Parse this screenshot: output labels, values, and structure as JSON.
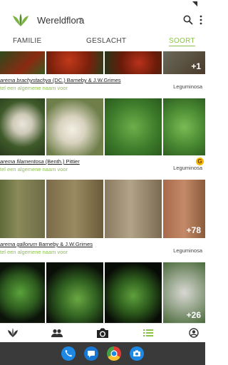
{
  "app": {
    "title": "Wereldflora"
  },
  "tabs": [
    {
      "label": "FAMILIE",
      "active": false
    },
    {
      "label": "GESLACHT",
      "active": false
    },
    {
      "label": "SOORT",
      "active": true
    }
  ],
  "species": [
    {
      "genus_part": "arema brachystachya",
      "author": " (DC.) Barneby & J.W.Grimes",
      "common": "tel een algemene naam voor",
      "family": "Leguminosa",
      "more": "+1"
    },
    {
      "genus_part": "arema filamentosa",
      "author": " (Benth.) Pittier",
      "common": "tel een algemene naam voor",
      "family": "Leguminosa",
      "badge": "G"
    },
    {
      "genus_part": "arema gallorum",
      "author": " Barneby & J.W.Grimes",
      "common": "tel een algemene naam voor",
      "family": "Leguminosa",
      "more": "+78"
    },
    {
      "more": "+26"
    }
  ],
  "colors": {
    "accent": "#8bc34a",
    "nav_active": "#8bc34a",
    "android_bar": "#3a3a3a"
  },
  "nav": [
    "plants-icon",
    "community-icon",
    "camera-icon",
    "list-icon",
    "profile-icon"
  ],
  "dock": [
    "phone-icon",
    "messages-icon",
    "chrome-icon",
    "camera-app-icon"
  ]
}
